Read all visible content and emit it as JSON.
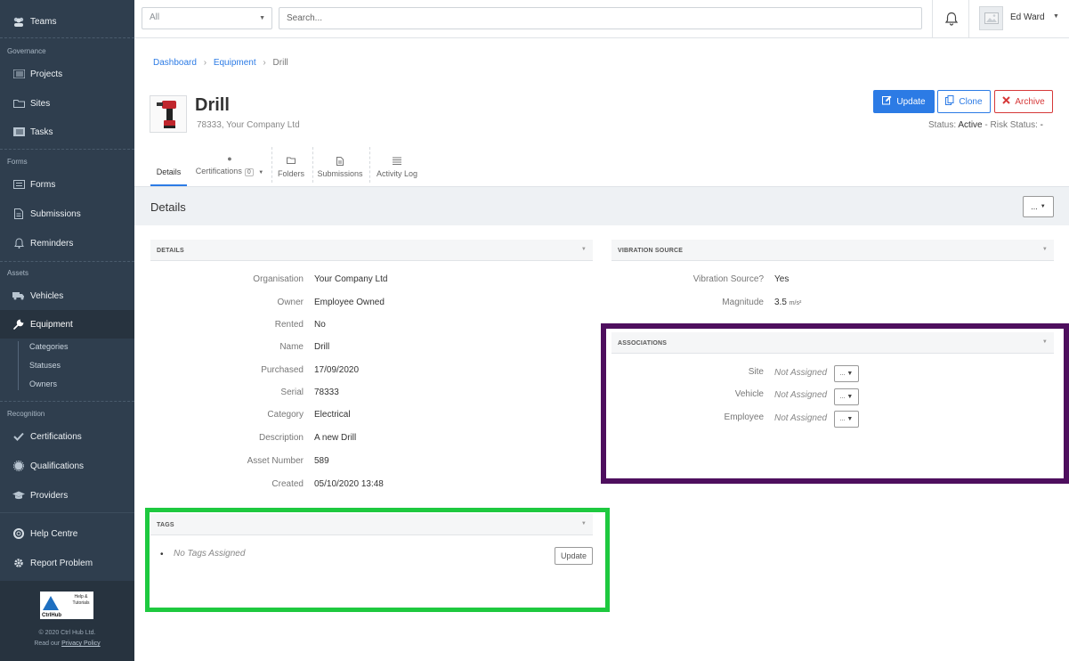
{
  "sidebar": {
    "items": {
      "teams": "Teams",
      "projects": "Projects",
      "sites": "Sites",
      "tasks": "Tasks",
      "forms": "Forms",
      "submissions": "Submissions",
      "reminders": "Reminders",
      "vehicles": "Vehicles",
      "equipment": "Equipment",
      "certifications": "Certifications",
      "qualifications": "Qualifications",
      "providers": "Providers",
      "help": "Help Centre",
      "report": "Report Problem"
    },
    "sections": {
      "governance": "Governance",
      "forms": "Forms",
      "assets": "Assets",
      "recognition": "Recognition"
    },
    "subitems": {
      "categories": "Categories",
      "statuses": "Statuses",
      "owners": "Owners"
    },
    "logo": {
      "name": "CtrlHub",
      "help": "Help & Tutorials"
    },
    "copyright": "© 2020 Ctrl Hub Ltd.",
    "privacy_prefix": "Read our",
    "privacy_link": "Privacy Policy"
  },
  "topbar": {
    "filter_value": "All",
    "search_placeholder": "Search...",
    "user_name": "Ed Ward"
  },
  "breadcrumb": {
    "dashboard": "Dashboard",
    "equipment": "Equipment",
    "current": "Drill"
  },
  "header": {
    "title": "Drill",
    "subtitle": "78333, Your Company Ltd",
    "buttons": {
      "update": "Update",
      "clone": "Clone",
      "archive": "Archive"
    },
    "status_label": "Status:",
    "status_value": "Active",
    "risk_label": "Risk Status:",
    "risk_value": "-"
  },
  "tabs": {
    "details": "Details",
    "certifications": "Certifications",
    "certifications_count": "0",
    "folders": "Folders",
    "submissions": "Submissions",
    "activity": "Activity Log"
  },
  "details_bar": {
    "title": "Details",
    "menu": "..."
  },
  "details_panel": {
    "heading": "DETAILS",
    "fields": {
      "organisation": {
        "label": "Organisation",
        "value": "Your Company Ltd"
      },
      "owner": {
        "label": "Owner",
        "value": "Employee Owned"
      },
      "rented": {
        "label": "Rented",
        "value": "No"
      },
      "name": {
        "label": "Name",
        "value": "Drill"
      },
      "purchased": {
        "label": "Purchased",
        "value": "17/09/2020"
      },
      "serial": {
        "label": "Serial",
        "value": "78333"
      },
      "category": {
        "label": "Category",
        "value": "Electrical"
      },
      "description": {
        "label": "Description",
        "value": "A new Drill"
      },
      "asset_number": {
        "label": "Asset Number",
        "value": "589"
      },
      "created": {
        "label": "Created",
        "value": "05/10/2020 13:48"
      }
    }
  },
  "vibration_panel": {
    "heading": "VIBRATION SOURCE",
    "source_label": "Vibration Source?",
    "source_value": "Yes",
    "magnitude_label": "Magnitude",
    "magnitude_value": "3.5",
    "magnitude_unit": "m/s²"
  },
  "associations_panel": {
    "heading": "ASSOCIATIONS",
    "site_label": "Site",
    "vehicle_label": "Vehicle",
    "employee_label": "Employee",
    "not_assigned": "Not Assigned",
    "menu": "..."
  },
  "tags_panel": {
    "heading": "TAGS",
    "empty_text": "No Tags Assigned",
    "update_label": "Update"
  },
  "colors": {
    "sidebar_bg": "#2f3e4e",
    "primary": "#2c7be5",
    "danger": "#d63939",
    "highlight_purple": "#4e0f5e",
    "highlight_green": "#1ec93f"
  }
}
